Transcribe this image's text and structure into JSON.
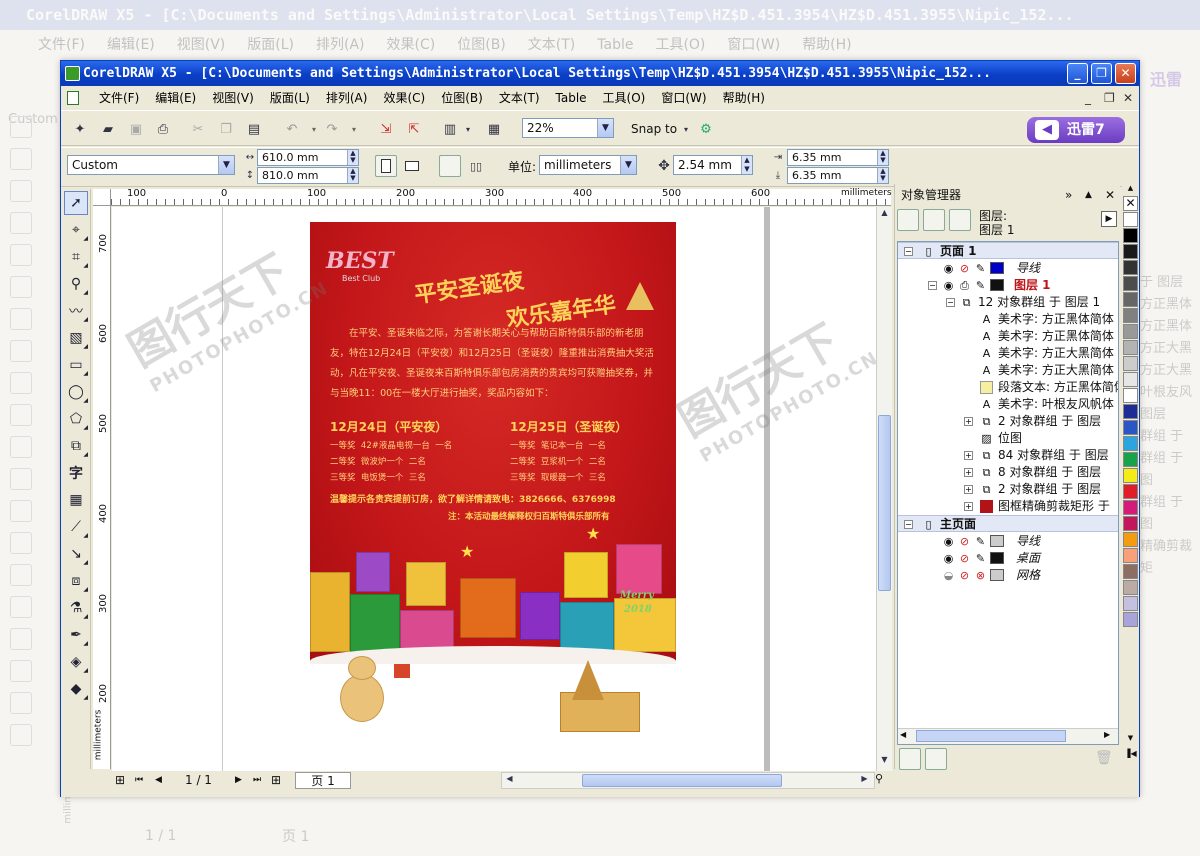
{
  "background_window": {
    "title": "CorelDRAW X5 - [C:\\Documents and Settings\\Administrator\\Local Settings\\Temp\\HZ$D.451.3954\\HZ$D.451.3955\\Nipic_152...",
    "menu": [
      "文件(F)",
      "编辑(E)",
      "视图(V)",
      "版面(L)",
      "排列(A)",
      "效果(C)",
      "位图(B)",
      "文本(T)",
      "Table",
      "工具(O)",
      "窗口(W)",
      "帮助(H)"
    ],
    "combo": "Custom",
    "xunlei": "迅雷",
    "side_items": [
      "于 图层",
      "方正黑体",
      "方正黑体",
      "方正大黑",
      "方正大黑",
      "叶根友风",
      "图层",
      "群组 于",
      "群组 于 图",
      "群组 于 图",
      "精确剪裁矩"
    ],
    "ruler_label": "millimeters",
    "page_counter": "1 / 1",
    "page_tab": "页 1"
  },
  "window": {
    "title": "CorelDRAW X5 - [C:\\Documents and Settings\\Administrator\\Local Settings\\Temp\\HZ$D.451.3954\\HZ$D.451.3955\\Nipic_152...",
    "controls": {
      "minimize": "_",
      "restore": "❐",
      "close": "✕"
    },
    "accent": "#0a3fc6"
  },
  "menubar": {
    "items": [
      "文件(F)",
      "编辑(E)",
      "视图(V)",
      "版面(L)",
      "排列(A)",
      "效果(C)",
      "位图(B)",
      "文本(T)",
      "Table",
      "工具(O)",
      "窗口(W)",
      "帮助(H)"
    ],
    "doc_controls": [
      "_",
      "❐",
      "✕"
    ]
  },
  "toolbar": {
    "zoom": "22%",
    "snap": "Snap to",
    "xunlei_label": "迅雷7"
  },
  "propertybar": {
    "page_size": "Custom",
    "width": "610.0 mm",
    "height": "810.0 mm",
    "unit_label": "单位:",
    "unit": "millimeters",
    "nudge": "2.54 mm",
    "dup_x": "6.35 mm",
    "dup_y": "6.35 mm"
  },
  "rulers": {
    "h_ticks": [
      "100",
      "0",
      "100",
      "200",
      "300",
      "400",
      "500",
      "600"
    ],
    "h_unit": "millimeters",
    "v_ticks": [
      "700",
      "600",
      "500",
      "400",
      "300",
      "200"
    ],
    "v_unit": "millimeters"
  },
  "poster": {
    "logo": "BEST",
    "logo_sub": "Best Club",
    "headline_1": "平安圣诞夜",
    "headline_2": "欢乐嘉年华",
    "body": "在平安、圣诞来临之际，为答谢长期关心与帮助百斯特俱乐部的新老朋友，特在12月24日（平安夜）和12月25日（圣诞夜）隆重推出消费抽大奖活动，凡在平安夜、圣诞夜来百斯特俱乐部包房消费的贵宾均可获赠抽奖券，并与当晚11：00在一楼大厅进行抽奖，奖品内容如下：",
    "date_1": "12月24日（平安夜）",
    "date_2": "12月25日（圣诞夜）",
    "prizes_left": [
      [
        "一等奖",
        "42#液晶电视一台",
        "一名"
      ],
      [
        "二等奖",
        "微波炉一个",
        "二名"
      ],
      [
        "三等奖",
        "电饭煲一个",
        "三名"
      ]
    ],
    "prizes_right": [
      [
        "一等奖",
        "笔记本一台",
        "一名"
      ],
      [
        "二等奖",
        "豆浆机一个",
        "二名"
      ],
      [
        "三等奖",
        "取暖器一个",
        "三名"
      ]
    ],
    "booking": "温馨提示各贵宾提前订房，欲了解详情请致电：3826666、6376998",
    "note": "注：本活动最终解释权归百斯特俱乐部所有",
    "merry": "Merry",
    "year": "2018"
  },
  "page_nav": {
    "counter": "1 / 1",
    "tab": "页 1"
  },
  "docker": {
    "title": "对象管理器",
    "layer_label": "图层:",
    "layer_value": "图层 1",
    "page1": "页面 1",
    "guides": "导线",
    "layer1": "图层 1",
    "group12": "12 对象群组 于 图层 1",
    "items": [
      "美术字: 方正黑体简体",
      "美术字: 方正黑体简体",
      "美术字: 方正大黑简体",
      "美术字: 方正大黑简体",
      "段落文本: 方正黑体简体",
      "美术字: 叶根友风帆体"
    ],
    "group2a": "2 对象群组 于 图层",
    "bitmap": "位图",
    "group84": "84 对象群组 于 图层",
    "group8": "8 对象群组 于 图层",
    "group2b": "2 对象群组 于 图层",
    "powerclip": "图框精确剪裁矩形 于",
    "master": "主页面",
    "m_guides": "导线",
    "desktop": "桌面",
    "grid": "网格",
    "colors": {
      "page_guides": "#0000cc",
      "layer1": "#111111",
      "master_guides": "#cccccc",
      "desktop": "#111111",
      "grid": "#cccccc"
    }
  },
  "palette": [
    "#ffffff",
    "#000000",
    "#1a1a1a",
    "#333333",
    "#4d4d4d",
    "#666666",
    "#808080",
    "#999999",
    "#b3b3b3",
    "#cccccc",
    "#e6e6e6",
    "#ffffff",
    "#1e2d96",
    "#2a56c6",
    "#2aa5e0",
    "#16a34a",
    "#f3ec16",
    "#e11d2a",
    "#d61a7a",
    "#c2185b",
    "#f39c12",
    "#f7a07a",
    "#8d6e63",
    "#bcaaa4",
    "#c5c0e0",
    "#a8a3d8",
    "#8c86cc",
    "#7a74c0",
    "#6a62b3",
    "#5a52a6"
  ],
  "watermarks": [
    "图行天下",
    "PHOTOPHOTO.CN"
  ]
}
